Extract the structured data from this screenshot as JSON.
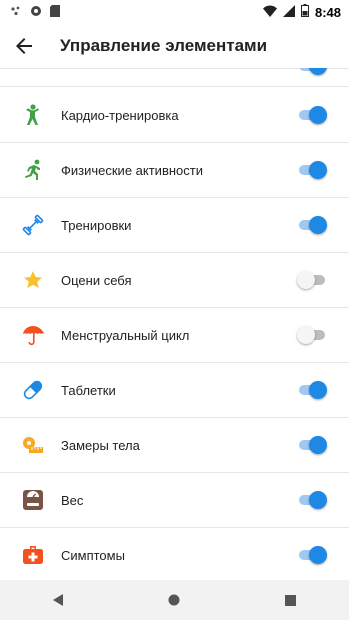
{
  "status_bar": {
    "time": "8:48"
  },
  "app_bar": {
    "title": "Управление элементами",
    "back_icon": "arrow-back-icon"
  },
  "items": [
    {
      "label": "Кардио-тренировка",
      "icon": "running-person-icon",
      "icon_color": "#43a047",
      "enabled": true
    },
    {
      "label": "Физические активности",
      "icon": "sprinting-person-icon",
      "icon_color": "#43a047",
      "enabled": true
    },
    {
      "label": "Тренировки",
      "icon": "dumbbell-icon",
      "icon_color": "#1e88e5",
      "enabled": true
    },
    {
      "label": "Оцени себя",
      "icon": "star-icon",
      "icon_color": "#fbc02d",
      "enabled": false
    },
    {
      "label": "Менструальный цикл",
      "icon": "umbrella-icon",
      "icon_color": "#f4511e",
      "enabled": false
    },
    {
      "label": "Таблетки",
      "icon": "pill-icon",
      "icon_color": "#1e88e5",
      "enabled": true
    },
    {
      "label": "Замеры тела",
      "icon": "measuring-tape-icon",
      "icon_color": "#f9a825",
      "enabled": true
    },
    {
      "label": "Вес",
      "icon": "scale-icon",
      "icon_color": "#795548",
      "enabled": true
    },
    {
      "label": "Симптомы",
      "icon": "first-aid-kit-icon",
      "icon_color": "#f4511e",
      "enabled": true
    }
  ],
  "colors": {
    "switch_on": "#1e88e5",
    "switch_on_track": "#9fc9f3",
    "switch_off_track": "#bdbdbd"
  }
}
